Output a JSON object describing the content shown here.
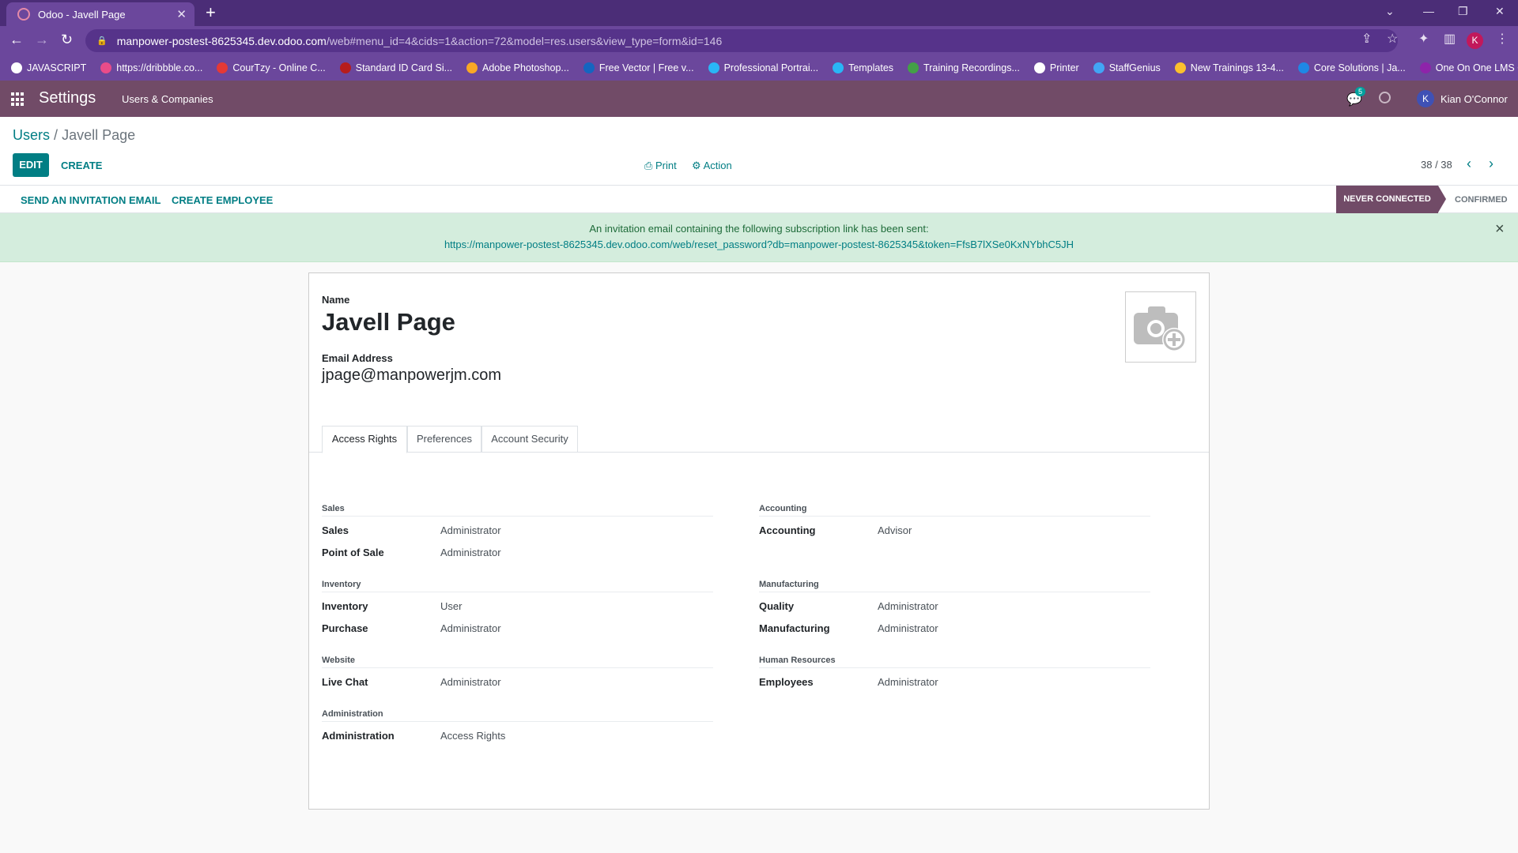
{
  "browser": {
    "tab_title": "Odoo - Javell Page",
    "url_host": "manpower-postest-8625345.dev.odoo.com",
    "url_path": "/web#menu_id=4&cids=1&action=72&model=res.users&view_type=form&id=146",
    "profile_initial": "K",
    "bookmarks": [
      {
        "label": "JAVASCRIPT",
        "color": "#ffffff"
      },
      {
        "label": "https://dribbble.co...",
        "color": "#ea4c89"
      },
      {
        "label": "CourTzy - Online C...",
        "color": "#e53935"
      },
      {
        "label": "Standard ID Card Si...",
        "color": "#b71c1c"
      },
      {
        "label": "Adobe Photoshop...",
        "color": "#f9a825"
      },
      {
        "label": "Free Vector | Free v...",
        "color": "#1565c0"
      },
      {
        "label": "Professional Portrai...",
        "color": "#29b6f6"
      },
      {
        "label": "Templates",
        "color": "#29b6f6"
      },
      {
        "label": "Training Recordings...",
        "color": "#43a047"
      },
      {
        "label": "Printer",
        "color": "#ffffff"
      },
      {
        "label": "StaffGenius",
        "color": "#42a5f5"
      },
      {
        "label": "New Trainings 13-4...",
        "color": "#fbc02d"
      },
      {
        "label": "Core Solutions | Ja...",
        "color": "#1e88e5"
      },
      {
        "label": "One On One LMS O...",
        "color": "#8e24aa"
      }
    ]
  },
  "navbar": {
    "app": "Settings",
    "menu": "Users & Companies",
    "chat_count": "5",
    "user_initial": "K",
    "user_name": "Kian O'Connor"
  },
  "control_panel": {
    "breadcrumb_parent": "Users",
    "breadcrumb_sep": "/",
    "breadcrumb_current": "Javell Page",
    "edit": "EDIT",
    "create": "CREATE",
    "print": "Print",
    "action": "Action",
    "pager": "38 / 38"
  },
  "statusbar": {
    "send_invitation": "SEND AN INVITATION EMAIL",
    "create_employee": "CREATE EMPLOYEE",
    "stage_active": "NEVER CONNECTED",
    "stage_next": "CONFIRMED"
  },
  "alert": {
    "message": "An invitation email containing the following subscription link has been sent:",
    "link": "https://manpower-postest-8625345.dev.odoo.com/web/reset_password?db=manpower-postest-8625345&token=FfsB7lXSe0KxNYbhC5JH"
  },
  "form": {
    "name_label": "Name",
    "name": "Javell Page",
    "email_label": "Email Address",
    "email": "jpage@manpowerjm.com",
    "tabs": [
      "Access Rights",
      "Preferences",
      "Account Security"
    ],
    "groups": {
      "sales": {
        "title": "Sales",
        "fields": [
          {
            "label": "Sales",
            "value": "Administrator"
          },
          {
            "label": "Point of Sale",
            "value": "Administrator"
          }
        ]
      },
      "accounting": {
        "title": "Accounting",
        "fields": [
          {
            "label": "Accounting",
            "value": "Advisor"
          }
        ]
      },
      "inventory": {
        "title": "Inventory",
        "fields": [
          {
            "label": "Inventory",
            "value": "User"
          },
          {
            "label": "Purchase",
            "value": "Administrator"
          }
        ]
      },
      "manufacturing": {
        "title": "Manufacturing",
        "fields": [
          {
            "label": "Quality",
            "value": "Administrator"
          },
          {
            "label": "Manufacturing",
            "value": "Administrator"
          }
        ]
      },
      "website": {
        "title": "Website",
        "fields": [
          {
            "label": "Live Chat",
            "value": "Administrator"
          }
        ]
      },
      "hr": {
        "title": "Human Resources",
        "fields": [
          {
            "label": "Employees",
            "value": "Administrator"
          }
        ]
      },
      "administration": {
        "title": "Administration",
        "fields": [
          {
            "label": "Administration",
            "value": "Access Rights"
          }
        ]
      }
    }
  }
}
